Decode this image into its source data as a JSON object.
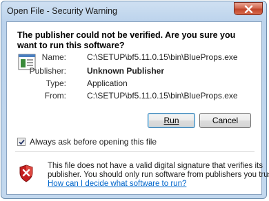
{
  "window": {
    "title": "Open File - Security Warning"
  },
  "headline": "The publisher could not be verified.  Are you sure you want to run this software?",
  "fields": [
    {
      "label": "Name:",
      "value": "C:\\SETUP\\bf5.11.0.15\\bin\\BlueProps.exe"
    },
    {
      "label": "Publisher:",
      "value": "Unknown Publisher"
    },
    {
      "label": "Type:",
      "value": "Application"
    },
    {
      "label": "From:",
      "value": "C:\\SETUP\\bf5.11.0.15\\bin\\BlueProps.exe"
    }
  ],
  "buttons": {
    "run": "Run",
    "cancel": "Cancel"
  },
  "checkbox": {
    "label": "Always ask before opening this file",
    "checked": true
  },
  "info": {
    "line1": "This file does not have a valid digital signature that verifies its",
    "line2": "publisher.  You should only run software from publishers you trust.",
    "link": "How can I decide what software to run?"
  },
  "icons": {
    "close": "close-icon",
    "app": "application-icon",
    "warning": "security-shield-icon",
    "check": "checkmark-icon"
  },
  "colors": {
    "titlebar": "#c3d8ee",
    "close_button": "#c2452b",
    "link": "#0066cc",
    "shield_red": "#c41f1f"
  }
}
